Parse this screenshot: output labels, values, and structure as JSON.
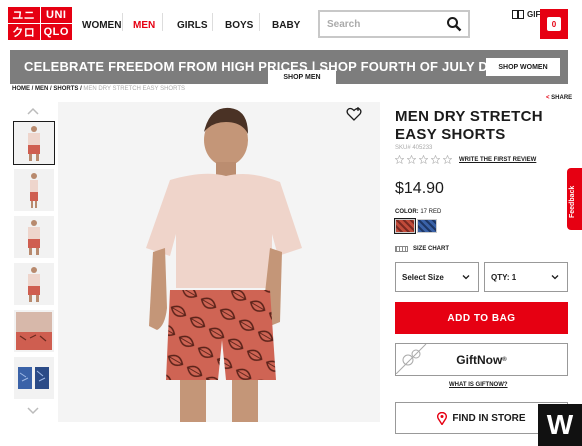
{
  "logo": {
    "cells": [
      "ユニ",
      "UNI",
      "クロ",
      "QLO"
    ]
  },
  "nav": {
    "items": [
      {
        "label": "WOMEN",
        "active": false
      },
      {
        "label": "MEN",
        "active": true
      },
      {
        "label": "GIRLS",
        "active": false
      },
      {
        "label": "BOYS",
        "active": false
      },
      {
        "label": "BABY",
        "active": false
      }
    ]
  },
  "search": {
    "placeholder": "Search"
  },
  "header": {
    "gift_label": "GIFT",
    "cart_count": "0"
  },
  "banner": {
    "text": "CELEBRATE FREEDOM FROM HIGH PRICES | SHOP FOURTH OF JULY DEALS NOW",
    "shop_men": "SHOP MEN",
    "shop_women": "SHOP WOMEN"
  },
  "breadcrumb": {
    "items": [
      "HOME",
      "MEN",
      "SHORTS"
    ],
    "current": "MEN DRY STRETCH EASY SHORTS"
  },
  "share_label": "SHARE",
  "product": {
    "title": "MEN DRY STRETCH EASY SHORTS",
    "sku": "SKU# 405233",
    "rating": 0,
    "review_link": "WRITE THE FIRST REVIEW",
    "price": "$14.90",
    "color_label": "COLOR:",
    "color_value": "17 RED",
    "size_chart": "SIZE CHART",
    "size_select": "Select Size",
    "qty_select": "QTY: 1",
    "add_to_bag": "ADD TO BAG",
    "giftnow": "GiftNow",
    "what_giftnow": "WHAT IS GIFTNOW?",
    "find_in_store": "FIND IN STORE"
  },
  "feedback_label": "Feedback",
  "badge_letter": "W",
  "colors": {
    "brand_red": "#e60012",
    "banner_gray": "#7d7d7d"
  }
}
